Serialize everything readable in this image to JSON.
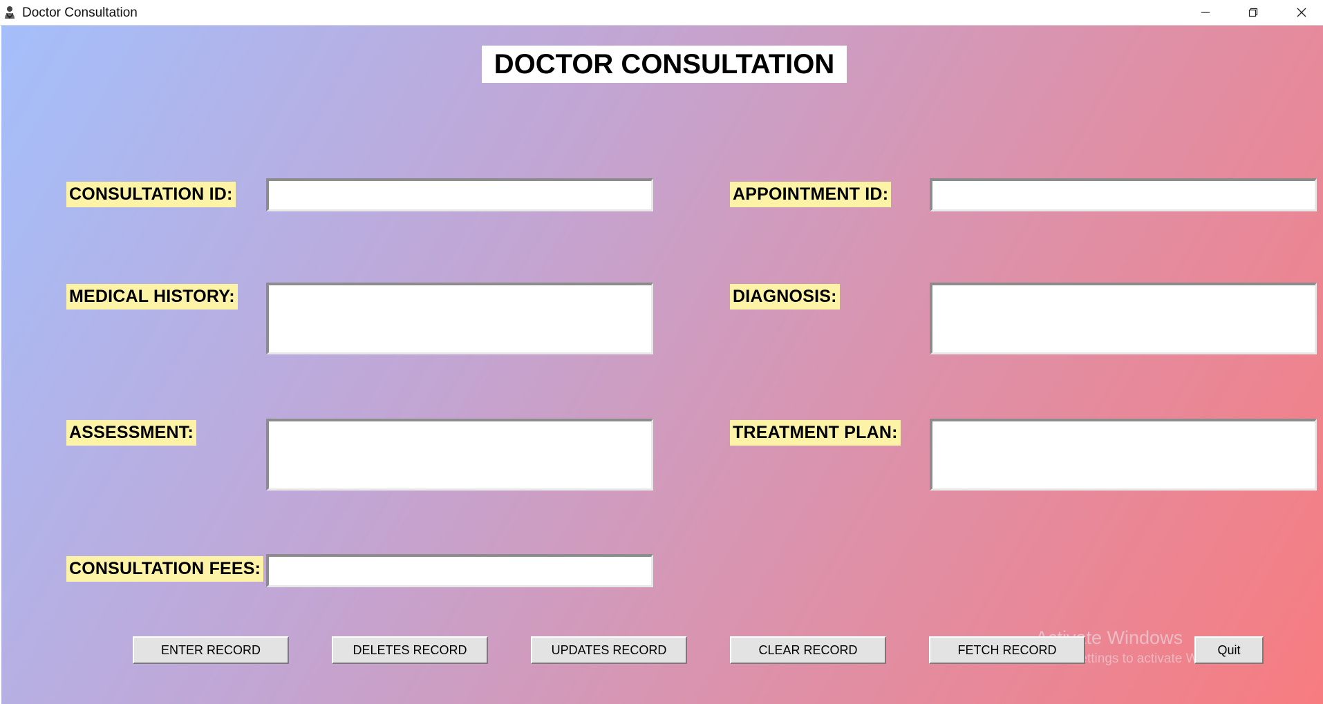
{
  "window": {
    "title": "Doctor Consultation",
    "icon": "stethoscope-icon"
  },
  "form": {
    "heading": "DOCTOR CONSULTATION",
    "fields": {
      "consultation_id": {
        "label": "CONSULTATION ID:",
        "value": ""
      },
      "appointment_id": {
        "label": "APPOINTMENT ID:",
        "value": ""
      },
      "medical_history": {
        "label": "MEDICAL HISTORY:",
        "value": ""
      },
      "diagnosis": {
        "label": "DIAGNOSIS:",
        "value": ""
      },
      "assessment": {
        "label": "ASSESSMENT:",
        "value": ""
      },
      "treatment_plan": {
        "label": "TREATMENT PLAN:",
        "value": ""
      },
      "consultation_fees": {
        "label": "CONSULTATION FEES:",
        "value": ""
      }
    }
  },
  "buttons": {
    "enter": "ENTER RECORD",
    "delete": "DELETES RECORD",
    "update": "UPDATES RECORD",
    "clear": "CLEAR RECORD",
    "fetch": "FETCH RECORD",
    "quit": "Quit"
  },
  "watermark": {
    "title": "Activate Windows",
    "subtitle": "Go to Settings to activate Windows."
  },
  "colors": {
    "label_bg": "#fdf3a6",
    "gradient_start": "#a4bffb",
    "gradient_end": "#f77c80"
  }
}
